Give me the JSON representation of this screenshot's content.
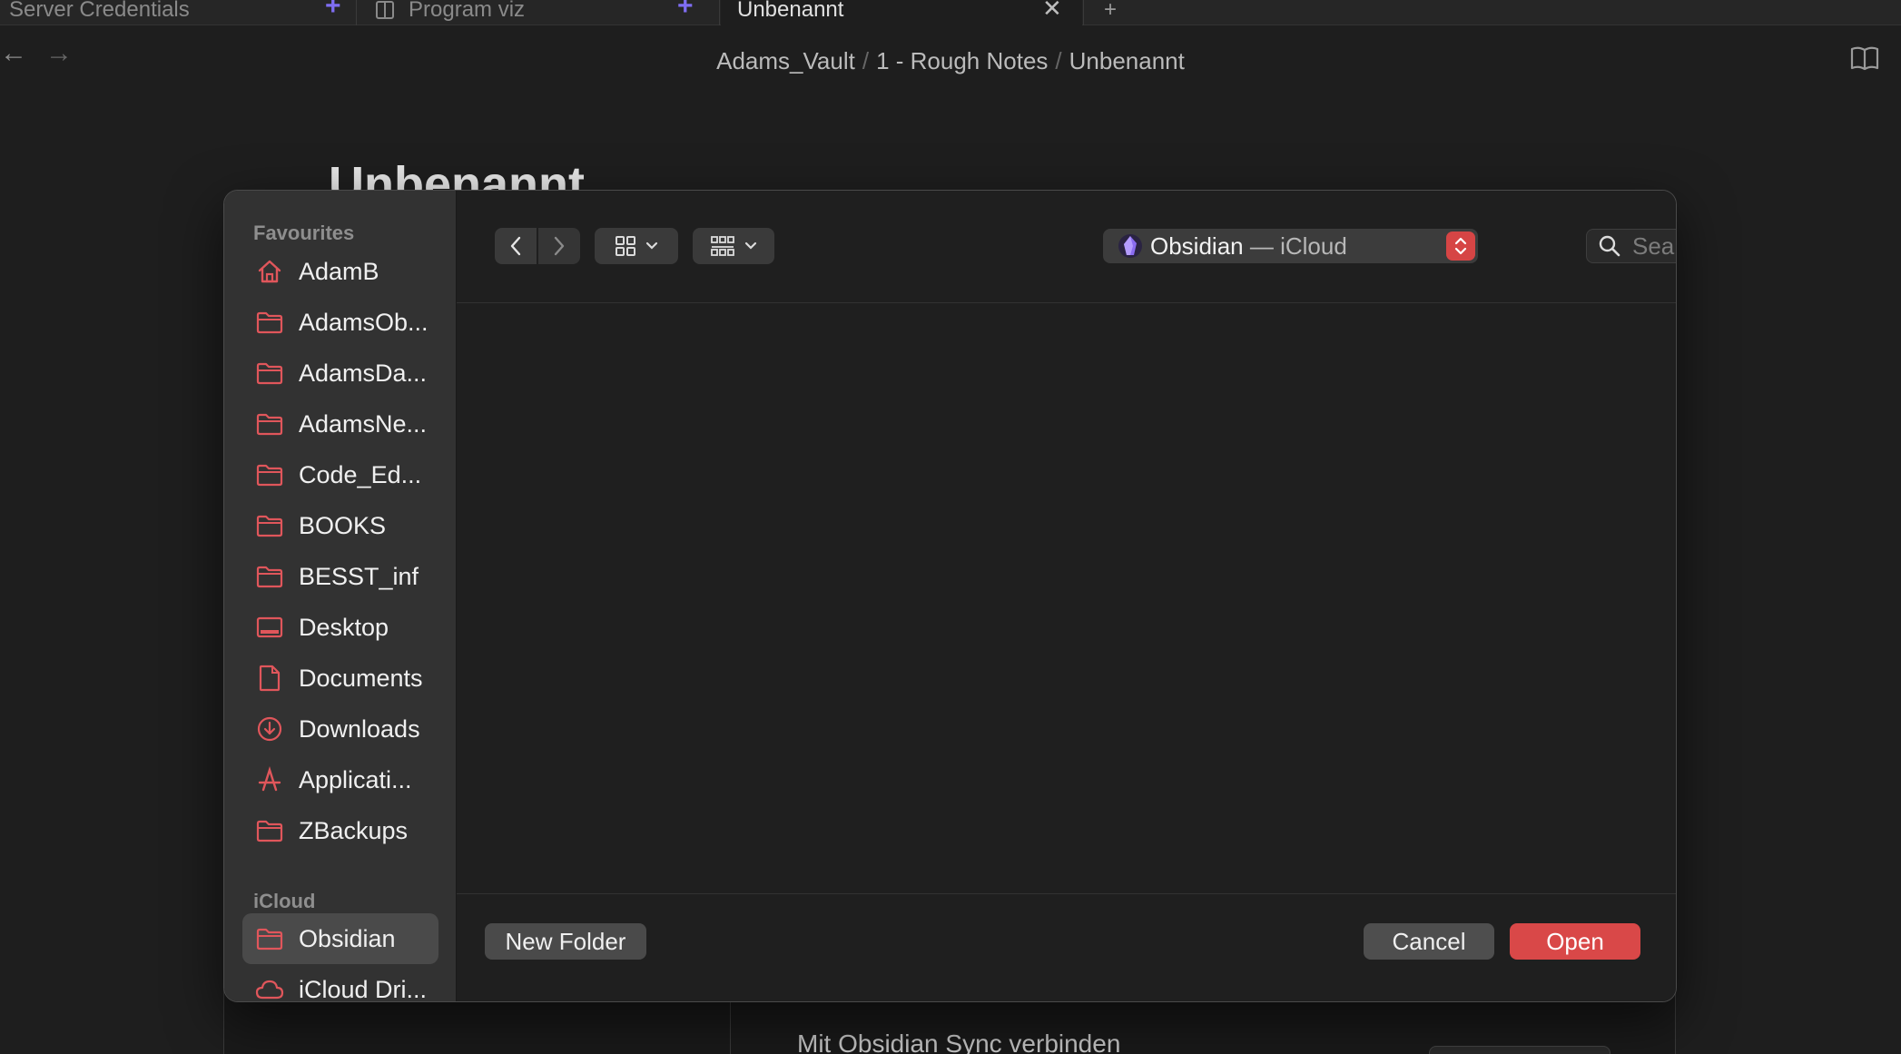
{
  "tabs": [
    {
      "label": "Server Credentials"
    },
    {
      "label": "Program viz"
    },
    {
      "label": "Unbenannt"
    }
  ],
  "breadcrumb": {
    "vault": "Adams_Vault",
    "folder": "1 - Rough Notes",
    "note": "Unbenannt",
    "separator": "/"
  },
  "note": {
    "title": "Unbenannt"
  },
  "background": {
    "sync_text": "Mit Obsidian Sync verbinden"
  },
  "dialog": {
    "sidebar": {
      "favourites_label": "Favourites",
      "favourites": [
        {
          "label": "AdamB",
          "icon": "home-icon"
        },
        {
          "label": "AdamsOb...",
          "icon": "folder-icon"
        },
        {
          "label": "AdamsDa...",
          "icon": "folder-icon"
        },
        {
          "label": "AdamsNe...",
          "icon": "folder-icon"
        },
        {
          "label": "Code_Ed...",
          "icon": "folder-icon"
        },
        {
          "label": "BOOKS",
          "icon": "folder-icon"
        },
        {
          "label": "BESST_inf",
          "icon": "folder-icon"
        },
        {
          "label": "Desktop",
          "icon": "desktop-icon"
        },
        {
          "label": "Documents",
          "icon": "document-icon"
        },
        {
          "label": "Downloads",
          "icon": "download-icon"
        },
        {
          "label": "Applicati...",
          "icon": "applications-icon"
        },
        {
          "label": "ZBackups",
          "icon": "folder-icon"
        }
      ],
      "icloud_label": "iCloud",
      "icloud": [
        {
          "label": "Obsidian",
          "icon": "folder-icon",
          "selected": true
        },
        {
          "label": "iCloud Dri...",
          "icon": "cloud-icon"
        }
      ]
    },
    "location": {
      "name": "Obsidian",
      "separator": " — ",
      "sub": "iCloud"
    },
    "search": {
      "placeholder": "Search",
      "value": ""
    },
    "buttons": {
      "new_folder": "New Folder",
      "cancel": "Cancel",
      "open": "Open"
    },
    "colors": {
      "accent": "#d94848",
      "icon_tint": "#e0565b",
      "obsidian_purple": "#7f6df2"
    }
  }
}
